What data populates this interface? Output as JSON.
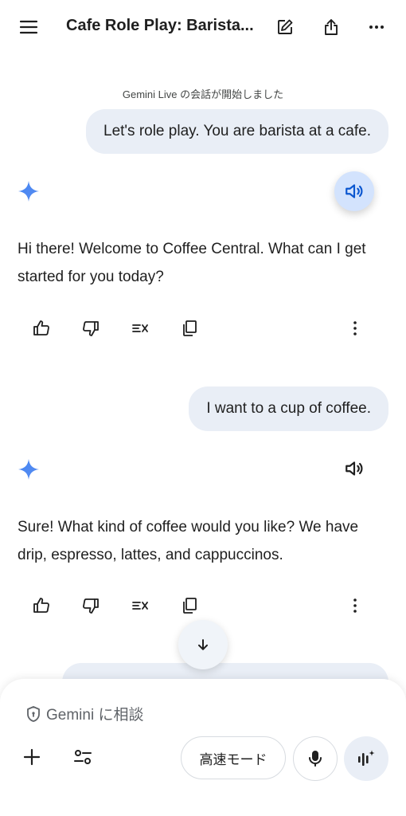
{
  "header": {
    "title": "Cafe Role Play: Barista...",
    "icons": [
      "menu-icon",
      "edit-icon",
      "share-icon",
      "more-icon"
    ]
  },
  "conversation": {
    "live_notice": "Gemini Live の会話が開始しました",
    "messages": [
      {
        "role": "user",
        "text": "Let's role play. You are barista at a cafe."
      },
      {
        "role": "model",
        "text": "Hi there! Welcome to Coffee Central. What can I get started for you today?",
        "speaker_playing": true
      },
      {
        "role": "user",
        "text": "I want to a cup of coffee."
      },
      {
        "role": "model",
        "text": "Sure! What kind of coffee would you like? We have drip, espresso, lattes, and cappuccinos.",
        "speaker_playing": false
      }
    ],
    "response_actions": [
      "thumbs-up-icon",
      "thumbs-down-icon",
      "modify-response-icon",
      "copy-icon",
      "more-vertical-icon"
    ]
  },
  "composer": {
    "placeholder": "Gemini に相談",
    "mode_label": "高速モード",
    "icons": [
      "shield-icon",
      "plus-icon",
      "tune-icon",
      "microphone-icon",
      "live-icon"
    ]
  },
  "colors": {
    "accent_blue": "#4285f4",
    "bubble_bg": "#e9eef6",
    "speaker_active_bg": "#d3e3fd"
  }
}
